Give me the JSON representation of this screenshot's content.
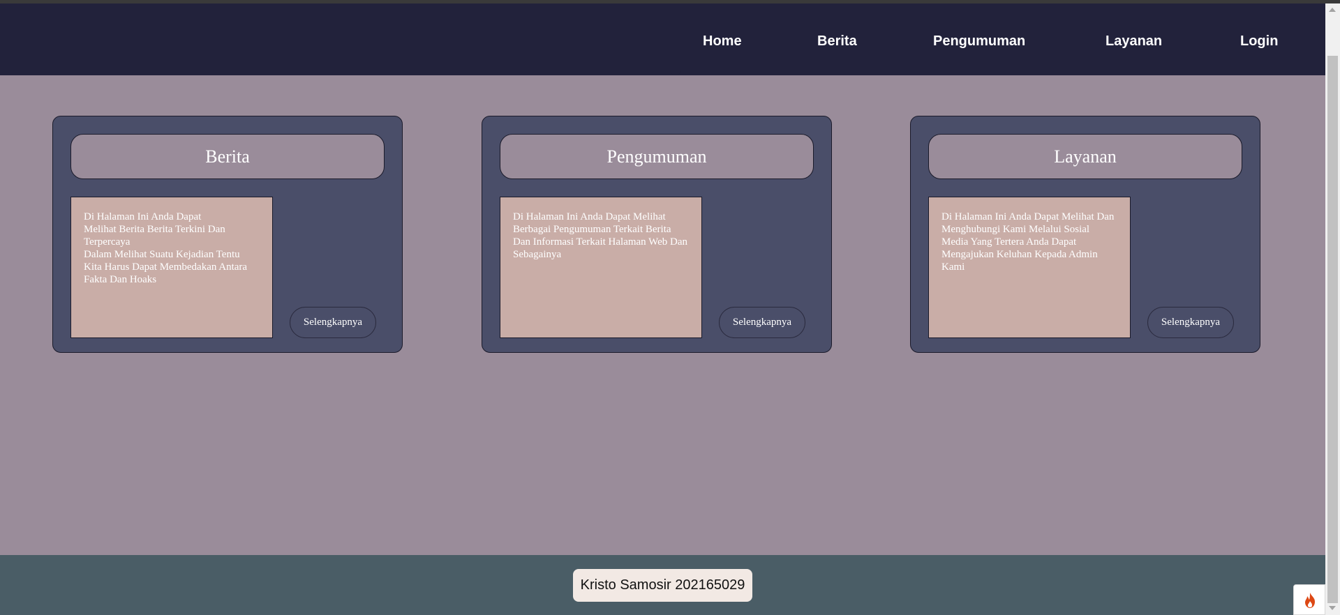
{
  "nav": {
    "items": [
      {
        "label": "Home"
      },
      {
        "label": "Berita"
      },
      {
        "label": "Pengumuman"
      },
      {
        "label": "Layanan"
      },
      {
        "label": "Login"
      }
    ]
  },
  "cards": [
    {
      "title": "Berita",
      "description": "Di Halaman Ini Anda Dapat\nMelihat Berita Berita Terkini Dan Terpercaya\nDalam Melihat Suatu Kejadian Tentu Kita Harus Dapat Membedakan Antara Fakta Dan Hoaks",
      "button": "Selengkapnya"
    },
    {
      "title": "Pengumuman",
      "description": "Di Halaman Ini Anda Dapat Melihat Berbagai Pengumuman Terkait Berita Dan Informasi Terkait Halaman Web Dan Sebagainya",
      "button": "Selengkapnya"
    },
    {
      "title": "Layanan",
      "description": "Di Halaman Ini Anda Dapat Melihat Dan Menghubungi Kami Melalui Sosial Media Yang Tertera Anda Dapat Mengajukan Keluhan Kepada Admin Kami",
      "button": "Selengkapnya"
    }
  ],
  "footer": {
    "text": "Kristo Samosir 202165029"
  },
  "colors": {
    "navbar": "#22223b",
    "page": "#9a8c9a",
    "card": "#4a4e69",
    "description_box": "#c9ada7",
    "footer": "#4a5d66",
    "footer_badge": "#f2e9e4"
  },
  "icons": {
    "floating_button": "flame-icon"
  }
}
